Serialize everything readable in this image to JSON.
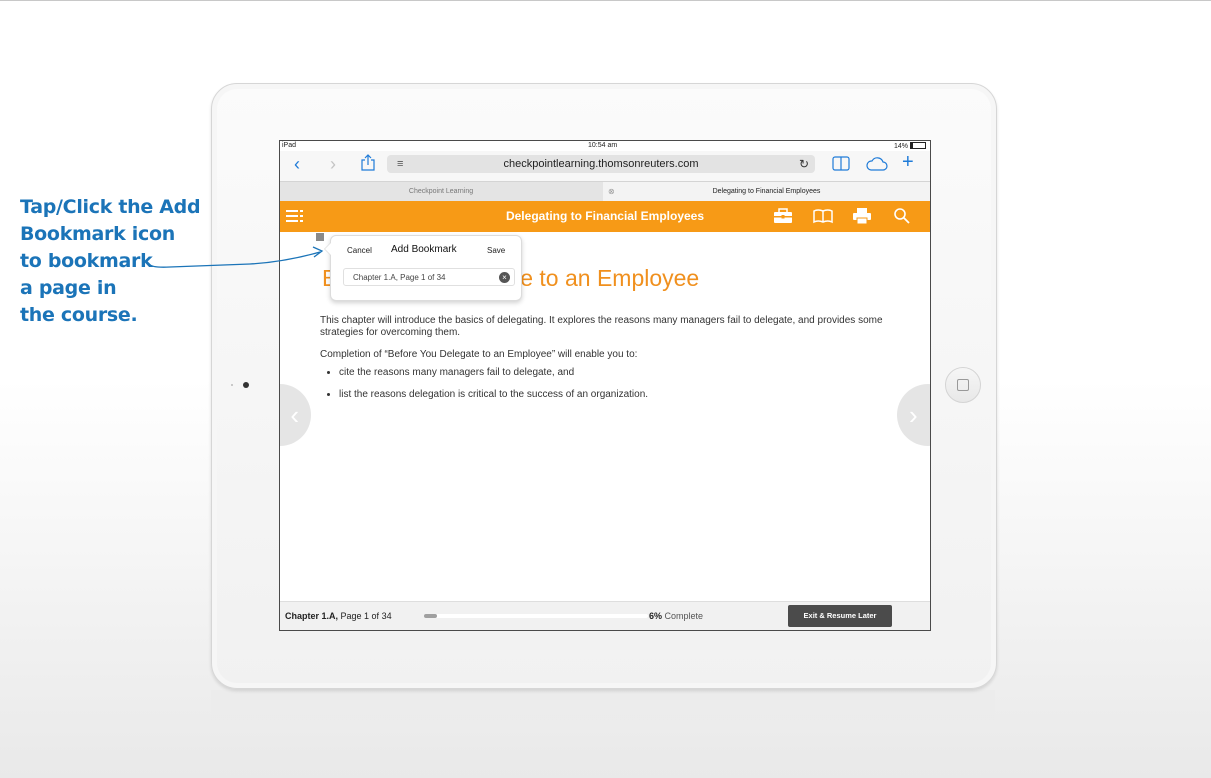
{
  "annotation": {
    "lines": [
      "Tap/Click the Add",
      "Bookmark icon",
      "to bookmark",
      "a page in",
      "the course."
    ]
  },
  "statusbar": {
    "carrier": "iPad",
    "time": "10:54 am",
    "battery": "14%"
  },
  "browser": {
    "url": "checkpointlearning.thomsonreuters.com",
    "tabs": [
      {
        "label": "Checkpoint Learning"
      },
      {
        "label": "Delegating to Financial Employees"
      }
    ]
  },
  "appbar": {
    "title": "Delegating to Financial Employees",
    "icons": [
      "menu-icon",
      "toolbox-icon",
      "book-icon",
      "print-icon",
      "search-icon"
    ]
  },
  "page": {
    "heading": "Before You Delegate to an Employee",
    "intro": "This chapter will introduce the basics of delegating. It explores the reasons many managers fail to delegate, and provides some strategies for overcoming them.",
    "completion": "Completion of “Before You Delegate to an Employee” will enable you to:",
    "bullets": [
      "cite the reasons many managers fail to delegate, and",
      "list the reasons delegation is critical to the success of an organization."
    ]
  },
  "popover": {
    "cancel": "Cancel",
    "title": "Add Bookmark",
    "save": "Save",
    "field_value": "Chapter 1.A, Page 1 of 34"
  },
  "footer": {
    "chapter": "Chapter 1.A,",
    "page": "Page 1 of 34",
    "percent": "6%",
    "percent_label": "Complete",
    "progress_fraction": 0.06,
    "exit": "Exit & Resume Later"
  },
  "colors": {
    "accent": "#f79a16",
    "annotation": "#1b74b8",
    "link": "#1f7bd8"
  }
}
